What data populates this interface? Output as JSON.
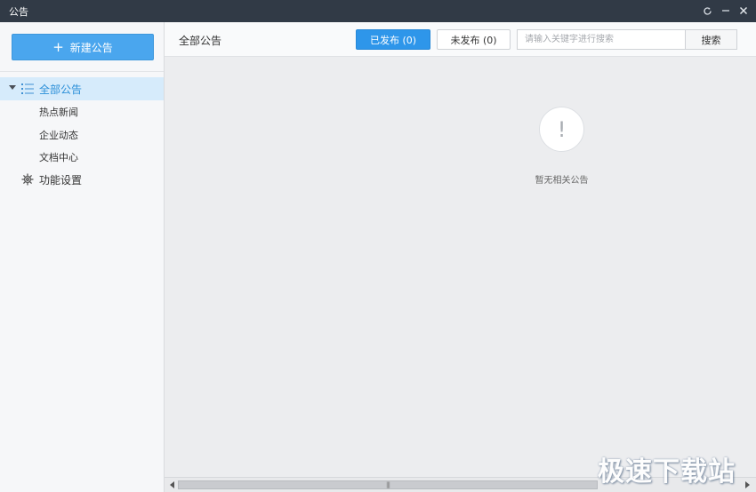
{
  "window": {
    "title": "公告",
    "icons": {
      "refresh": "refresh-icon",
      "minimize": "minimize-icon",
      "close": "close-icon"
    }
  },
  "sidebar": {
    "new_button": {
      "icon": "plus-icon",
      "label": "新建公告"
    },
    "tree": {
      "root": {
        "label": "全部公告",
        "icon": "list-icon",
        "expanded": true,
        "selected": true
      },
      "children": [
        "热点新闻",
        "企业动态",
        "文档中心"
      ]
    },
    "settings": {
      "icon": "gear-icon",
      "label": "功能设置"
    }
  },
  "main": {
    "title": "全部公告",
    "tabs": {
      "published": "已发布 (0)",
      "unpublished": "未发布 (0)"
    },
    "search": {
      "placeholder": "请输入关键字进行搜索",
      "value": "",
      "button": "搜索"
    },
    "empty_state": {
      "icon": "exclamation-icon",
      "symbol": "!",
      "text": "暂无相关公告"
    },
    "scrollbar": {
      "grip": "|||"
    }
  },
  "watermark": "极速下载站",
  "colors": {
    "titlebar": "#313a46",
    "accent": "#2e96ea",
    "new_button": "#4aa6ee",
    "selected_row": "#d6ebfb",
    "selected_text": "#2b8fd8"
  }
}
